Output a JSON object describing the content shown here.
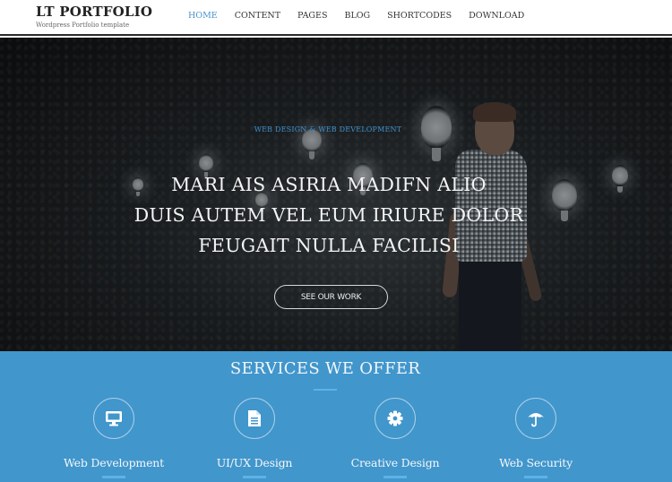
{
  "header": {
    "site_title": "LT PORTFOLIO",
    "tagline": "Wordpress Portfolio template",
    "nav": [
      {
        "label": "HOME",
        "active": true
      },
      {
        "label": "CONTENT",
        "active": false
      },
      {
        "label": "PAGES",
        "active": false
      },
      {
        "label": "BLOG",
        "active": false
      },
      {
        "label": "SHORTCODES",
        "active": false
      },
      {
        "label": "DOWNLOAD",
        "active": false
      }
    ]
  },
  "hero": {
    "kicker": "WEB DESIGN & WEB DEVELOPMENT",
    "title_lines": [
      "MARI AIS ASIRIA MADIFN ALIO",
      "DUIS AUTEM VEL EUM IRIURE DOLOR",
      "FEUGAIT NULLA FACILISI"
    ],
    "cta_label": "SEE OUR WORK"
  },
  "services": {
    "title": "SERVICES WE OFFER",
    "items": [
      {
        "label": "Web Development",
        "icon": "monitor-icon"
      },
      {
        "label": "UI/UX Design",
        "icon": "document-icon"
      },
      {
        "label": "Creative Design",
        "icon": "gear-icon"
      },
      {
        "label": "Web Security",
        "icon": "umbrella-icon"
      }
    ]
  },
  "colors": {
    "accent": "#4a94cc",
    "services_bg": "#4196cc",
    "kicker": "#3d8fcd"
  }
}
